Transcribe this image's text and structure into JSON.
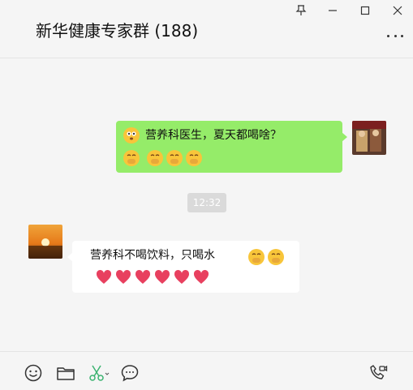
{
  "header": {
    "title": "新华健康专家群 (188)",
    "icons": [
      "pin-icon",
      "minimize-icon",
      "maximize-icon",
      "close-icon",
      "more-icon"
    ]
  },
  "messages": [
    {
      "direction": "outgoing",
      "text": "营养科医生，夏天都喝啥？",
      "emojis": [
        "thinking-face",
        "hand-over-mouth",
        "hand-over-mouth",
        "hand-over-mouth",
        "hand-over-mouth"
      ]
    },
    {
      "direction": "timestamp",
      "text": "12:32"
    },
    {
      "direction": "incoming",
      "text": "营养科不喝饮料，只喝水",
      "emojis": [
        "hand-over-mouth",
        "hand-over-mouth",
        "heart",
        "heart",
        "heart",
        "heart",
        "heart",
        "heart"
      ]
    }
  ],
  "toolbar": {
    "icons": [
      "emoji-icon",
      "folder-icon",
      "scissors-icon",
      "chat-bubble-icon",
      "video-call-icon"
    ]
  },
  "colors": {
    "outgoing_bubble": "#95ec69",
    "incoming_bubble": "#ffffff",
    "background": "#f5f5f5",
    "scissors": "#3cb371",
    "heart": "#e8405f"
  }
}
